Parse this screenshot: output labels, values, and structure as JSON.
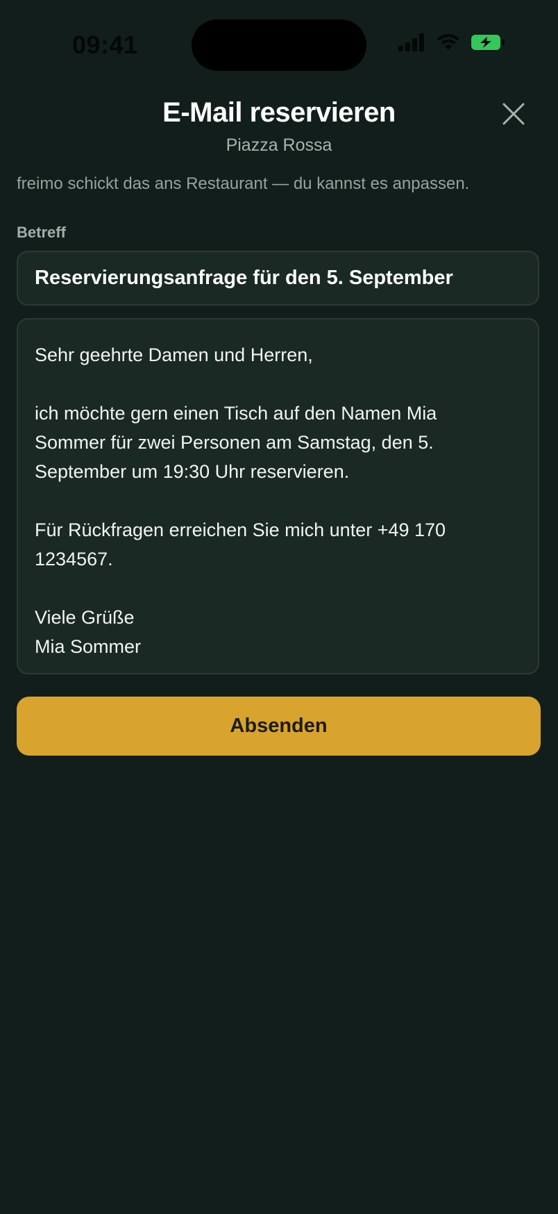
{
  "status_bar": {
    "time": "09:41",
    "battery_color": "#34c759"
  },
  "header": {
    "title": "E-Mail reservieren",
    "subtitle": "Piazza Rossa",
    "close_icon": "close-icon"
  },
  "hint": "freimo schickt das ans Restaurant — du kannst es anpassen.",
  "form": {
    "subject_label": "Betreff",
    "subject_value": "Reservierungsanfrage für den 5. September",
    "body_lines": [
      "Sehr geehrte Damen und Herren,",
      "",
      "ich möchte gern einen Tisch auf den Namen Mia",
      "Sommer für zwei Personen am Samstag, den 5.",
      "September um 19:30 Uhr reservieren.",
      "",
      "Für Rückfragen erreichen Sie mich unter +49 170",
      "1234567.",
      "",
      "Viele Grüße",
      "Mia Sommer"
    ]
  },
  "send_button": {
    "label": "Absenden",
    "color": "#d9a42d"
  },
  "colors": {
    "background": "#111e1b",
    "field_background": "#1a2924",
    "field_border": "#2c3a35"
  }
}
